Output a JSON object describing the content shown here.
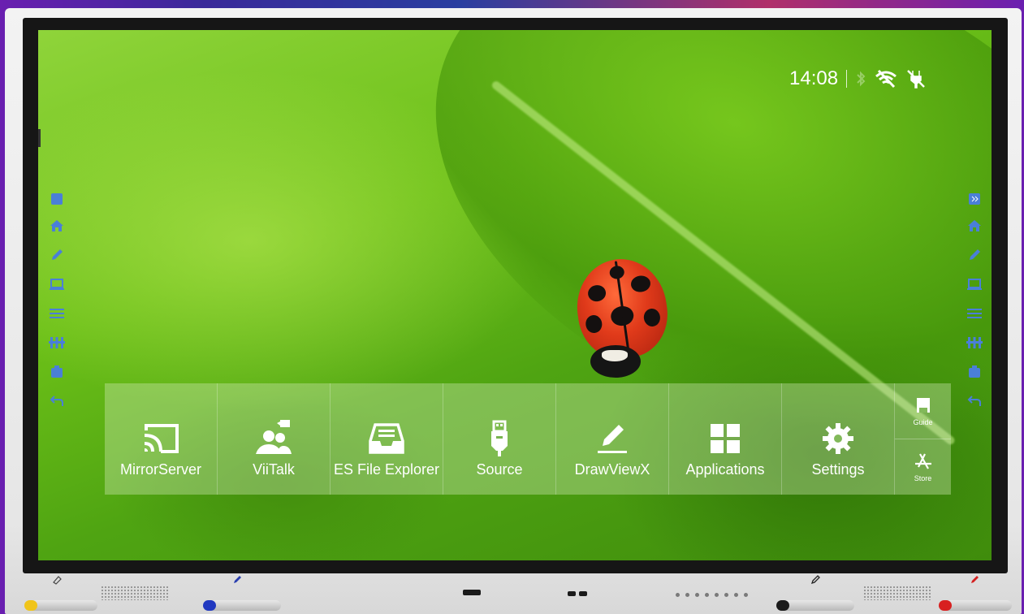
{
  "status_bar": {
    "time": "14:08"
  },
  "dock": {
    "apps": [
      {
        "label": "MirrorServer",
        "icon": "cast-icon"
      },
      {
        "label": "ViiTalk",
        "icon": "video-call-icon"
      },
      {
        "label": "ES File Explorer",
        "icon": "file-tray-icon"
      },
      {
        "label": "Source",
        "icon": "usb-plug-icon"
      },
      {
        "label": "DrawViewX",
        "icon": "pencil-icon"
      },
      {
        "label": "Applications",
        "icon": "grid-icon"
      },
      {
        "label": "Settings",
        "icon": "gear-icon"
      }
    ],
    "mini_apps": [
      {
        "label": "Guide",
        "icon": "floppy-icon"
      },
      {
        "label": "Store",
        "icon": "app-store-icon"
      }
    ]
  },
  "sidebar": {
    "items": [
      "collapse-icon",
      "home-icon",
      "pen-icon",
      "laptop-icon",
      "menu-icon",
      "tools-icon",
      "whiteboard-icon",
      "back-icon"
    ]
  },
  "colors": {
    "sidebar_icon": "#4a7fd8",
    "tile_bg": "rgba(210,235,185,0.38)",
    "wallpaper_green": "#6cc018",
    "ladybug_red": "#e03a1a"
  }
}
